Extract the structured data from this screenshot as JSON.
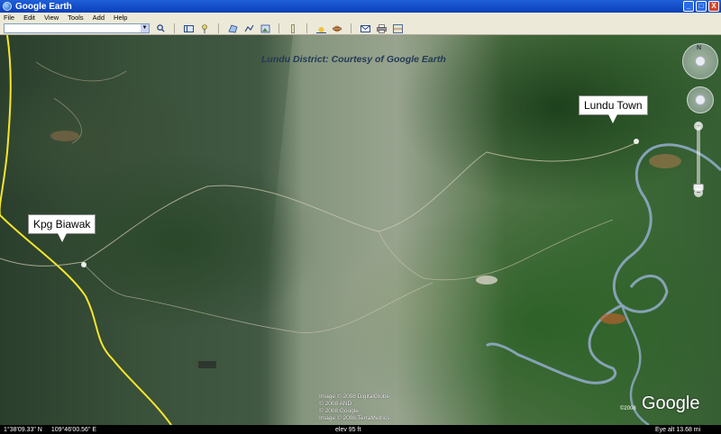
{
  "window": {
    "title": "Google Earth",
    "controls": [
      "_",
      "□",
      "X"
    ]
  },
  "menu": [
    "File",
    "Edit",
    "View",
    "Tools",
    "Add",
    "Help"
  ],
  "toolbar": {
    "search_value": "",
    "search_icon": "magnifier-icon"
  },
  "map": {
    "title": "Lundu District: Courtesy of Google Earth",
    "placemarks": [
      {
        "label": "Kpg Biawak"
      },
      {
        "label": "Lundu Town"
      }
    ],
    "credits": [
      "Image © 2008 DigitalGlobe",
      "© 2008 AND",
      "© 2008 Google",
      "Image © 2008 TerraMetrics"
    ],
    "logo": "Google",
    "logo_year": "©2008",
    "compass_n": "N",
    "zoom_plus": "+",
    "zoom_minus": "−"
  },
  "status": {
    "lat": "1°38'09.33\" N",
    "lon": "109°46'00.56\" E",
    "elev": "elev  95 ft",
    "eye_alt": "Eye alt    13.68 mi"
  },
  "colors": {
    "title_bar": "#0a3fb8",
    "country_border": "#f5e62a",
    "river": "#8fa9c4"
  }
}
